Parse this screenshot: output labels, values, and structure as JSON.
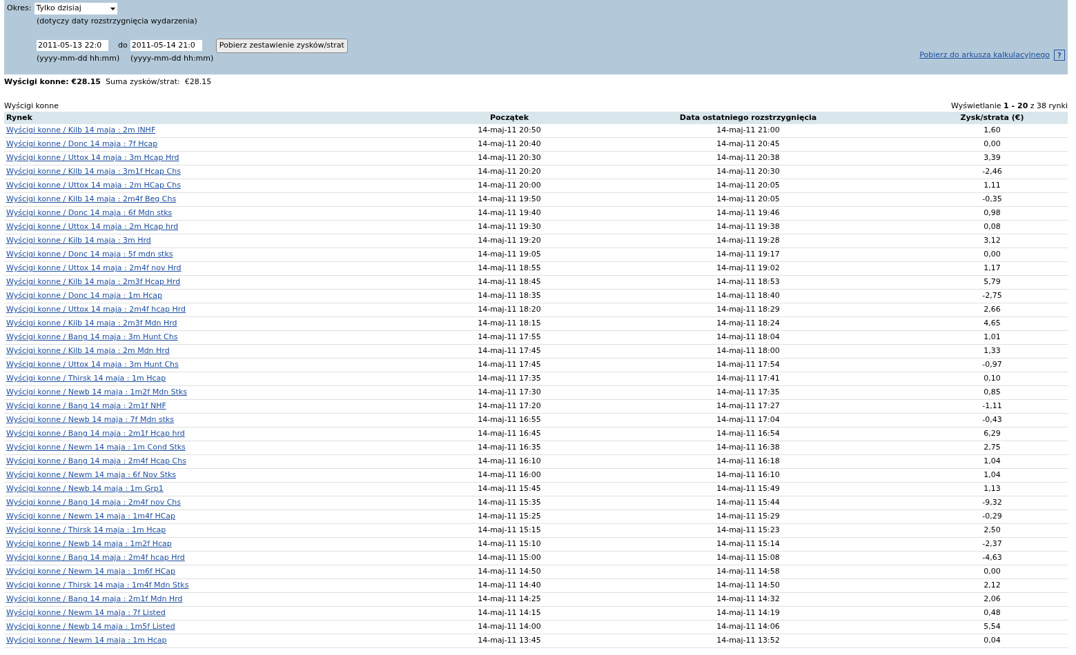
{
  "filter": {
    "period_label": "Okres:",
    "period_value": "Tylko dzisiaj",
    "period_note": "(dotyczy daty rozstrzygnięcia wydarzenia)",
    "from_value": "2011-05-13 22:0",
    "to_label": "do",
    "to_value": "2011-05-14 21:0",
    "from_format": "(yyyy-mm-dd hh:mm)",
    "to_format": "(yyyy-mm-dd hh:mm)",
    "submit_button": "Pobierz zestawienie zysków/strat",
    "export_link": "Pobierz do arkusza kalkulacyjnego",
    "help_button": "?"
  },
  "summary": {
    "text": "**Wyścigi konne: €28.15**  Suma zysków/strat:  €28.15"
  },
  "section_title": "Wyścigi konne",
  "pagination": "Wyświetlanie **1 - 20** z 38 rynki",
  "table": {
    "columns": [
      "Rynek",
      "Początek",
      "Data ostatniego rozstrzygnięcia",
      "Zysk/strata (€)"
    ],
    "rows": [
      [
        "Wyścigi konne / Kilb 14 maja : 2m INHF",
        "14-maj-11 20:50",
        "14-maj-11 21:00",
        "1,60"
      ],
      [
        "Wyścigi konne / Donc 14 maja : 7f Hcap",
        "14-maj-11 20:40",
        "14-maj-11 20:45",
        "0,00"
      ],
      [
        "Wyścigi konne / Uttox 14 maja : 3m Hcap Hrd",
        "14-maj-11 20:30",
        "14-maj-11 20:38",
        "3,39"
      ],
      [
        "Wyścigi konne / Kilb 14 maja : 3m1f Hcap Chs",
        "14-maj-11 20:20",
        "14-maj-11 20:30",
        "-2,46"
      ],
      [
        "Wyścigi konne / Uttox 14 maja : 2m HCap Chs",
        "14-maj-11 20:00",
        "14-maj-11 20:05",
        "1,11"
      ],
      [
        "Wyścigi konne / Kilb 14 maja : 2m4f Beg Chs",
        "14-maj-11 19:50",
        "14-maj-11 20:05",
        "-0,35"
      ],
      [
        "Wyścigi konne / Donc 14 maja : 6f Mdn stks",
        "14-maj-11 19:40",
        "14-maj-11 19:46",
        "0,98"
      ],
      [
        "Wyścigi konne / Uttox 14 maja : 2m Hcap hrd",
        "14-maj-11 19:30",
        "14-maj-11 19:38",
        "0,08"
      ],
      [
        "Wyścigi konne / Kilb 14 maja : 3m Hrd",
        "14-maj-11 19:20",
        "14-maj-11 19:28",
        "3,12"
      ],
      [
        "Wyścigi konne / Donc 14 maja : 5f mdn stks",
        "14-maj-11 19:05",
        "14-maj-11 19:17",
        "0,00"
      ],
      [
        "Wyścigi konne / Uttox 14 maja : 2m4f nov Hrd",
        "14-maj-11 18:55",
        "14-maj-11 19:02",
        "1,17"
      ],
      [
        "Wyścigi konne / Kilb 14 maja : 2m3f Hcap Hrd",
        "14-maj-11 18:45",
        "14-maj-11 18:53",
        "5,79"
      ],
      [
        "Wyścigi konne / Donc 14 maja : 1m Hcap",
        "14-maj-11 18:35",
        "14-maj-11 18:40",
        "-2,75"
      ],
      [
        "Wyścigi konne / Uttox 14 maja : 2m4f hcap Hrd",
        "14-maj-11 18:20",
        "14-maj-11 18:29",
        "2,66"
      ],
      [
        "Wyścigi konne / Kilb 14 maja : 2m3f Mdn Hrd",
        "14-maj-11 18:15",
        "14-maj-11 18:24",
        "4,65"
      ],
      [
        "Wyścigi konne / Bang 14 maja : 3m Hunt Chs",
        "14-maj-11 17:55",
        "14-maj-11 18:04",
        "1,01"
      ],
      [
        "Wyścigi konne / Kilb 14 maja : 2m Mdn Hrd",
        "14-maj-11 17:45",
        "14-maj-11 18:00",
        "1,33"
      ],
      [
        "Wyścigi konne / Uttox 14 maja : 3m Hunt Chs",
        "14-maj-11 17:45",
        "14-maj-11 17:54",
        "-0,97"
      ],
      [
        "Wyścigi konne / Thirsk 14 maja : 1m Hcap",
        "14-maj-11 17:35",
        "14-maj-11 17:41",
        "0,10"
      ],
      [
        "Wyścigi konne / Newb 14 maja : 1m2f Mdn Stks",
        "14-maj-11 17:30",
        "14-maj-11 17:35",
        "0,85"
      ],
      [
        "Wyścigi konne / Bang 14 maja : 2m1f NHF",
        "14-maj-11 17:20",
        "14-maj-11 17:27",
        "-1,11"
      ],
      [
        "Wyścigi konne / Newb 14 maja : 7f Mdn stks",
        "14-maj-11 16:55",
        "14-maj-11 17:04",
        "-0,43"
      ],
      [
        "Wyścigi konne / Bang 14 maja : 2m1f Hcap hrd",
        "14-maj-11 16:45",
        "14-maj-11 16:54",
        "6,29"
      ],
      [
        "Wyścigi konne / Newm 14 maja : 1m Cond Stks",
        "14-maj-11 16:35",
        "14-maj-11 16:38",
        "2,75"
      ],
      [
        "Wyścigi konne / Bang 14 maja : 2m4f Hcap Chs",
        "14-maj-11 16:10",
        "14-maj-11 16:18",
        "1,04"
      ],
      [
        "Wyścigi konne / Newm 14 maja : 6f Nov Stks",
        "14-maj-11 16:00",
        "14-maj-11 16:10",
        "1,04"
      ],
      [
        "Wyścigi konne / Newb 14 maja : 1m Grp1",
        "14-maj-11 15:45",
        "14-maj-11 15:49",
        "1,13"
      ],
      [
        "Wyścigi konne / Bang 14 maja : 2m4f nov Chs",
        "14-maj-11 15:35",
        "14-maj-11 15:44",
        "-9,32"
      ],
      [
        "Wyścigi konne / Newm 14 maja : 1m4f HCap",
        "14-maj-11 15:25",
        "14-maj-11 15:29",
        "-0,29"
      ],
      [
        "Wyścigi konne / Thirsk 14 maja : 1m Hcap",
        "14-maj-11 15:15",
        "14-maj-11 15:23",
        "2,50"
      ],
      [
        "Wyścigi konne / Newb 14 maja : 1m2f Hcap",
        "14-maj-11 15:10",
        "14-maj-11 15:14",
        "-2,37"
      ],
      [
        "Wyścigi konne / Bang 14 maja : 2m4f hcap Hrd",
        "14-maj-11 15:00",
        "14-maj-11 15:08",
        "-4,63"
      ],
      [
        "Wyścigi konne / Newm 14 maja : 1m6f HCap",
        "14-maj-11 14:50",
        "14-maj-11 14:58",
        "0,00"
      ],
      [
        "Wyścigi konne / Thirsk 14 maja : 1m4f Mdn Stks",
        "14-maj-11 14:40",
        "14-maj-11 14:50",
        "2,12"
      ],
      [
        "Wyścigi konne / Bang 14 maja : 2m1f Mdn Hrd",
        "14-maj-11 14:25",
        "14-maj-11 14:32",
        "2,06"
      ],
      [
        "Wyścigi konne / Newm 14 maja : 7f Listed",
        "14-maj-11 14:15",
        "14-maj-11 14:19",
        "0,48"
      ],
      [
        "Wyścigi konne / Newb 14 maja : 1m5f Listed",
        "14-maj-11 14:00",
        "14-maj-11 14:06",
        "5,54"
      ],
      [
        "Wyścigi konne / Newm 14 maja : 1m Hcap",
        "14-maj-11 13:45",
        "14-maj-11 13:52",
        "0,04"
      ]
    ]
  }
}
